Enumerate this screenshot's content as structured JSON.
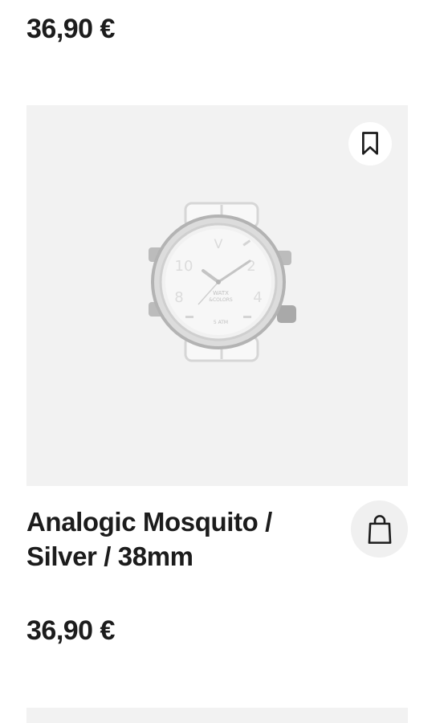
{
  "previous_product": {
    "price": "36,90 €"
  },
  "product": {
    "name": "Analogic Mosquito /\nSilver / 38mm",
    "price": "36,90 €",
    "image_icon": "watch-image",
    "bookmark_icon": "bookmark-icon",
    "cart_icon": "shopping-bag-icon"
  },
  "colors": {
    "image_background": "#f2f2f2",
    "cart_button_background": "#f0f0f0",
    "text": "#1c1c1c"
  }
}
